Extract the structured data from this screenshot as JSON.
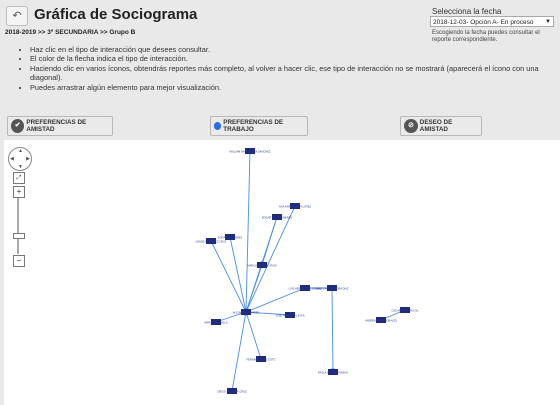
{
  "header": {
    "title": "Gráfica de Sociograma",
    "breadcrumb": "2018-2019 >> 3º SECUNDARIA >> Grupo B",
    "back_icon": "arrow-left-icon"
  },
  "date_picker": {
    "label": "Selecciona la fecha",
    "value": "2018-12-03- Opción A- En proceso",
    "help": "Escogiendo la fecha puedes consultar el reporte correspondiente."
  },
  "instructions": [
    "Haz clic en el tipo de interacción que desees consultar.",
    "El color de la flecha indica el tipo de interacción.",
    "Haciendo clic en varios íconos, obtendrás reportes más completo, al volver a hacer clic, ese tipo de interacción no se mostrará (aparecerá el ícono con una diagonal).",
    "Puedes arrastrar algún elemento para mejor visualización."
  ],
  "buttons": {
    "amistad": "PREFERENCIAS DE AMISTAD",
    "trabajo": "PREFERENCIAS DE TRABAJO",
    "deseo": "DESEO DE AMISTAD"
  },
  "colors": {
    "edge": "#4a8fe0",
    "node": "#1f2a7a",
    "node_label": "#2b3a8c"
  },
  "graph": {
    "nodes": [
      {
        "id": "n1",
        "label": "WILLIAM IVAN GARCIA SANCHEZ"
      },
      {
        "id": "n2",
        "label": "ANA KAREN MEJIA LOPEZ"
      },
      {
        "id": "n3",
        "label": "EDGAR ORTIZ RAMIREZ"
      },
      {
        "id": "n4",
        "label": "SOFIA LUNA PEREZ"
      },
      {
        "id": "n5",
        "label": "DANIELA JIMENEZ CRUZ"
      },
      {
        "id": "n6",
        "label": "MARCO ANTONIO RIOS"
      },
      {
        "id": "n7",
        "label": "LUIS HERNANDEZ GOMEZ"
      },
      {
        "id": "n8",
        "label": "JUAN CARLOS MORA DIAZ"
      },
      {
        "id": "n9",
        "label": "ALEJANDRA TORRES"
      },
      {
        "id": "n10",
        "label": "JOSE ROBERTO LEYVA"
      },
      {
        "id": "n11",
        "label": "MARIA JOSE VILLA"
      },
      {
        "id": "n12",
        "label": "FERNANDA RUIZ SOTO"
      },
      {
        "id": "n13",
        "label": "PAOLA CASTRO RAMOS"
      },
      {
        "id": "n14",
        "label": "DIEGO SALAZAR CRUZ"
      },
      {
        "id": "n15",
        "label": "ANDREA VEGA MORALES"
      },
      {
        "id": "n16",
        "label": "OSCAR NAVARRO GIL"
      }
    ]
  }
}
